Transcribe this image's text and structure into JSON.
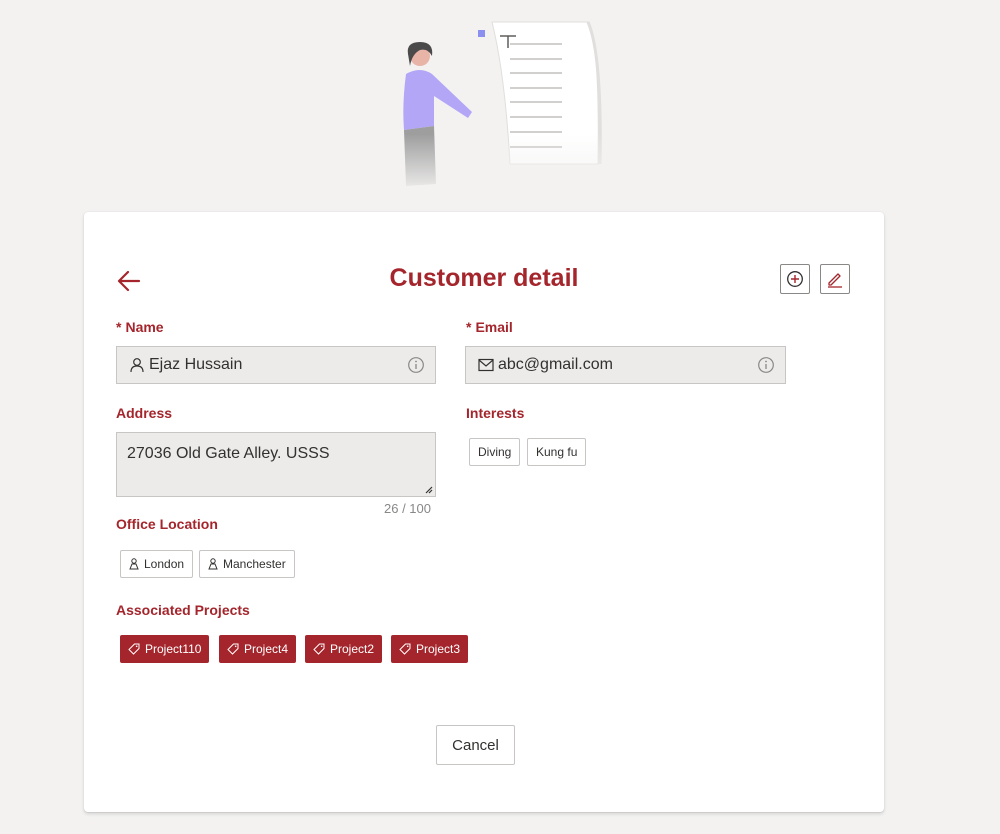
{
  "title": "Customer detail",
  "icons": {
    "back": "arrow-left-icon",
    "add": "add-circle-icon",
    "edit": "edit-pencil-icon",
    "name": "person-icon",
    "email": "mail-icon",
    "info": "info-icon",
    "location": "location-person-icon",
    "tag": "tag-icon"
  },
  "colors": {
    "accent": "#a4262c",
    "field_bg": "#edebe9",
    "page_bg": "#f3f2f1"
  },
  "form": {
    "name": {
      "required_mark": "*",
      "label": "Name",
      "value": "Ejaz Hussain"
    },
    "email": {
      "required_mark": "*",
      "label": "Email",
      "value": "abc@gmail.com"
    },
    "address": {
      "label": "Address",
      "value": "27036 Old Gate Alley. USSS",
      "counter": "26 / 100"
    },
    "interests": {
      "label": "Interests",
      "items": [
        "Diving",
        "Kung fu"
      ]
    },
    "office_location": {
      "label": "Office Location",
      "items": [
        "London",
        "Manchester"
      ]
    },
    "associated_projects": {
      "label": "Associated Projects",
      "items": [
        "Project110",
        "Project4",
        "Project2",
        "Project3"
      ]
    }
  },
  "actions": {
    "cancel_label": "Cancel"
  }
}
